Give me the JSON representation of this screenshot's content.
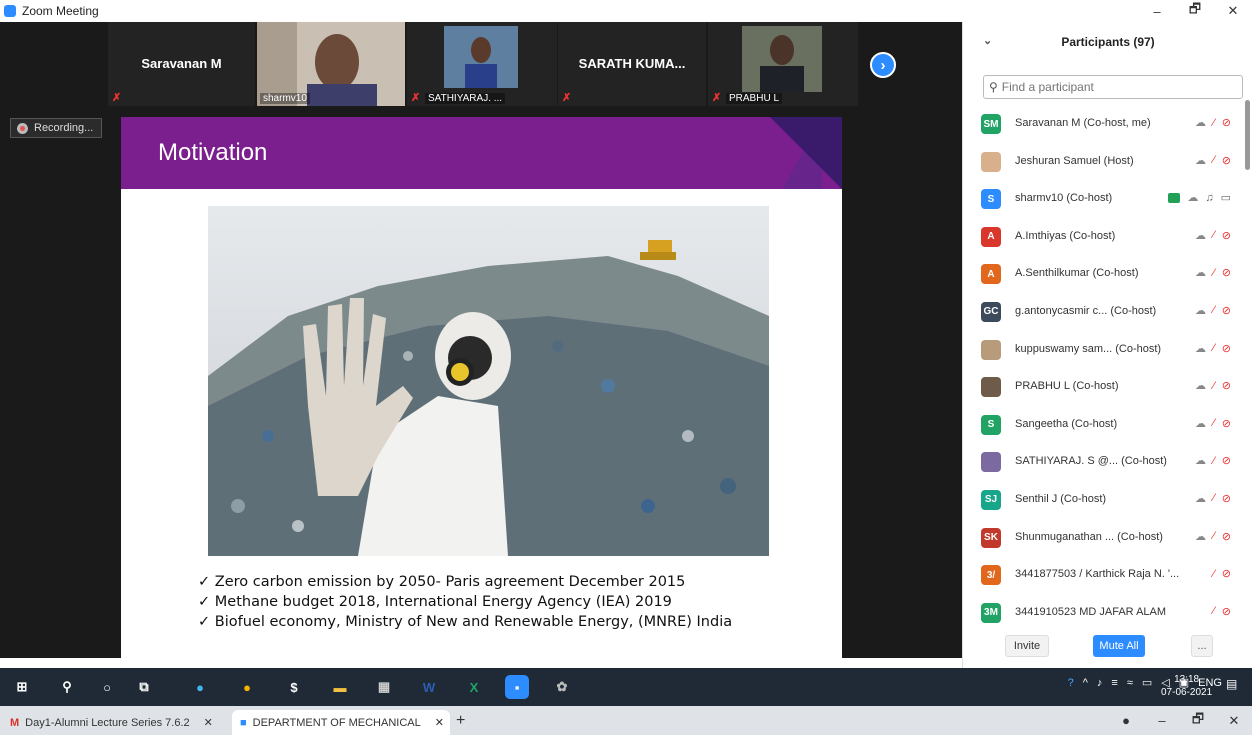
{
  "window": {
    "title": "Zoom Meeting",
    "minimize": "–",
    "maximize": "🗗",
    "close": "✕"
  },
  "gallery": {
    "tiles": [
      {
        "name": "Saravanan M"
      },
      {
        "name": "sharmv10"
      },
      {
        "name": "SATHIYARAJ. ..."
      },
      {
        "name": "SARATH KUMA..."
      },
      {
        "name": "PRABHU L"
      }
    ]
  },
  "recording": {
    "label": "Recording..."
  },
  "slide": {
    "title": "Motivation",
    "bullets": [
      "✓ Zero carbon emission by 2050- Paris agreement December 2015",
      "✓ Methane budget 2018, International Energy Agency (IEA) 2019",
      "✓ Biofuel economy, Ministry of New and Renewable Energy, (MNRE) India"
    ]
  },
  "participants": {
    "header": "Participants (97)",
    "search_placeholder": "Find a participant",
    "items": [
      {
        "initials": "SM",
        "color": "#21a366",
        "name": "Saravanan M (Co-host, me)"
      },
      {
        "initials": "",
        "color": "#d9b08c",
        "name": "Jeshuran Samuel (Host)"
      },
      {
        "initials": "S",
        "color": "#2d8cff",
        "name": "sharmv10 (Co-host)"
      },
      {
        "initials": "A",
        "color": "#d9372b",
        "name": "A.Imthiyas (Co-host)"
      },
      {
        "initials": "A",
        "color": "#e0671b",
        "name": "A.Senthilkumar (Co-host)"
      },
      {
        "initials": "GC",
        "color": "#3c4a5c",
        "name": "g.antonycasmir c...  (Co-host)"
      },
      {
        "initials": "",
        "color": "#b89b7a",
        "name": "kuppuswamy sam...  (Co-host)"
      },
      {
        "initials": "",
        "color": "#6f5b4a",
        "name": "PRABHU L (Co-host)"
      },
      {
        "initials": "S",
        "color": "#21a366",
        "name": "Sangeetha  (Co-host)"
      },
      {
        "initials": "",
        "color": "#7a6aa0",
        "name": "SATHIYARAJ. S @...  (Co-host)"
      },
      {
        "initials": "SJ",
        "color": "#17a689",
        "name": "Senthil J (Co-host)"
      },
      {
        "initials": "SK",
        "color": "#c0392b",
        "name": "Shunmuganathan ...  (Co-host)"
      },
      {
        "initials": "3/",
        "color": "#e0671b",
        "name": "3441877503 / Karthick Raja N. '..."
      },
      {
        "initials": "3M",
        "color": "#21a366",
        "name": "3441910523 MD JAFAR ALAM"
      }
    ],
    "invite": "Invite",
    "mute_all": "Mute All",
    "more": "..."
  },
  "taskbar": {
    "lang": "ENG",
    "time": "13:18",
    "date": "07-06-2021"
  },
  "browser": {
    "tabs": [
      {
        "label": "Day1-Alumni Lecture Series 7.6.2",
        "close": "✕"
      },
      {
        "label": "DEPARTMENT OF MECHANICAL",
        "close": "✕"
      }
    ],
    "new_tab": "+"
  }
}
